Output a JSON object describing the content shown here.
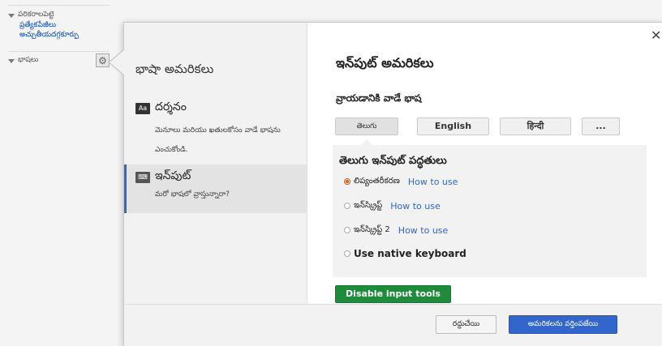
{
  "sidebar": {
    "tools": {
      "title": "పరికరాలపెట్టె",
      "links": [
        "ప్రత్యేకపేజీలు",
        "అచ్చుతీయదగ్గకూర్పు"
      ]
    },
    "languages": {
      "title": "భాషలు",
      "settings_icon": "gear-icon"
    }
  },
  "dialog": {
    "close_symbol": "✕",
    "menu": {
      "title": "భాషా అమరికలు",
      "items": [
        {
          "icon": "display-icon",
          "icon_text": "Aa",
          "label": "దర్శనం",
          "description": "మెనూలు మరియు ఖతులకోసం వాడే భాషను ఎంచుకోండి."
        },
        {
          "icon": "keyboard-icon",
          "label": "ఇన్‌పుట్",
          "description": "మరో భాషలో వ్రాస్తున్నారా?"
        }
      ]
    },
    "content": {
      "title": "ఇన్‌పుట్ అమరికలు",
      "language_heading": "వ్రాయడానికి వాడే భాష",
      "languages": [
        "తెలుగు",
        "English",
        "हिन्दी",
        "..."
      ],
      "selected_language": "తెలుగు",
      "methods_heading": "తెలుగు ఇన్‌పుట్ పద్ధతులు",
      "methods": [
        {
          "label": "లిప్యంతరీకరణ",
          "help": "How to use",
          "selected": true
        },
        {
          "label": "ఇన్‌స్క్రిప్ట్",
          "help": "How to use",
          "selected": false
        },
        {
          "label": "ఇన్‌స్క్రిప్ట్ 2",
          "help": "How to use",
          "selected": false
        },
        {
          "label": "Use native keyboard",
          "help": "",
          "selected": false
        }
      ],
      "disable_button": "Disable input tools"
    },
    "footer": {
      "cancel": "రద్దుచేయి",
      "apply": "అమరికలను వర్తింపజేయి"
    }
  },
  "colors": {
    "accent": "#3366cc",
    "disable_button": "#1e8c3a",
    "radio_selected": "#e8590c"
  }
}
